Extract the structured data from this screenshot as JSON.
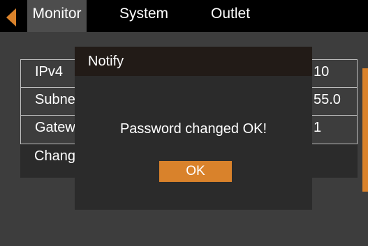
{
  "nav": {
    "tabs": [
      {
        "label": "Monitor",
        "active": true
      },
      {
        "label": "System",
        "active": false
      },
      {
        "label": "Outlet",
        "active": false
      }
    ],
    "back_icon": "caret-left-icon"
  },
  "network_settings": {
    "rows": [
      {
        "label": "IPv4",
        "value": "10"
      },
      {
        "label": "Subne",
        "value": "55.0"
      },
      {
        "label": "Gatew",
        "value": "1"
      },
      {
        "label": "Chang",
        "value": ""
      }
    ]
  },
  "dialog": {
    "title": "Notify",
    "message": "Password changed OK!",
    "ok_label": "OK"
  },
  "colors": {
    "accent": "#d9822b",
    "active_tab": "#4d4d4d",
    "panel_bg": "#3d3d3d",
    "dialog_bg": "#2b2b2b",
    "dialog_title_bg": "#221b17"
  }
}
